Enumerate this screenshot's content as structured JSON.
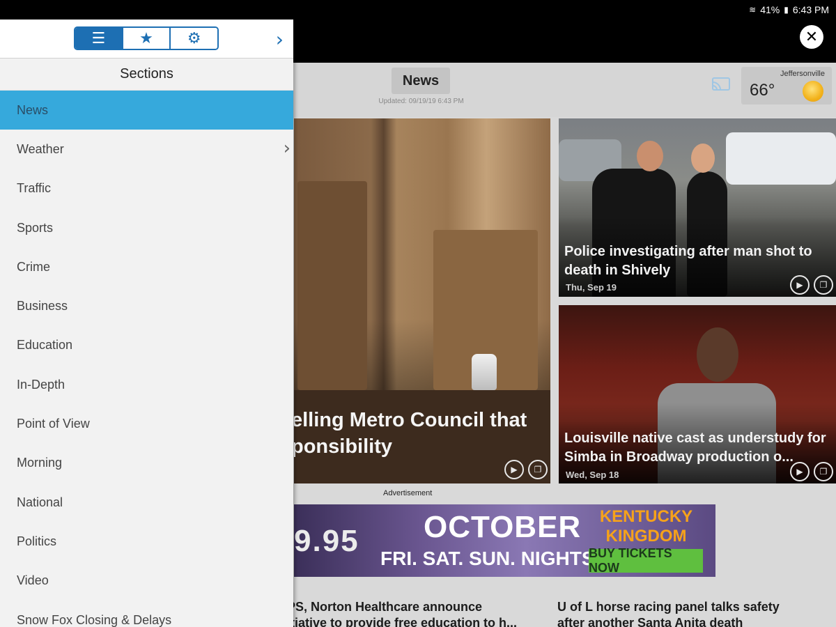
{
  "status_bar": {
    "battery": "41%",
    "time": "6:43 PM"
  },
  "header": {
    "section_title": "News",
    "updated_text": "Updated: 09/19/19 6:43 PM",
    "weather": {
      "city": "Jeffersonville",
      "temperature": "66°",
      "icon": "sun-icon"
    }
  },
  "drawer": {
    "tabs": [
      {
        "name": "sections",
        "icon": "list-icon",
        "glyph": "☰",
        "active": true
      },
      {
        "name": "favorites",
        "icon": "star-icon",
        "glyph": "★",
        "active": false
      },
      {
        "name": "settings",
        "icon": "gear-icon",
        "glyph": "⚙",
        "active": false
      }
    ],
    "title": "Sections",
    "items": [
      {
        "label": "News",
        "active": true
      },
      {
        "label": "Weather",
        "has_submenu": true
      },
      {
        "label": "Traffic"
      },
      {
        "label": "Sports"
      },
      {
        "label": "Crime"
      },
      {
        "label": "Business"
      },
      {
        "label": "Education"
      },
      {
        "label": "In-Depth"
      },
      {
        "label": "Point of View"
      },
      {
        "label": "Morning"
      },
      {
        "label": "National"
      },
      {
        "label": "Politics"
      },
      {
        "label": "Video"
      },
      {
        "label": "Snow Fox Closing & Delays"
      }
    ]
  },
  "stories": {
    "featured": {
      "headline_line1": "elling Metro Council that",
      "headline_line2": "ponsibility"
    },
    "side": [
      {
        "title": "Police investigating after man shot to death in Shively",
        "date": "Thu, Sep 19"
      },
      {
        "title": "Louisville native cast as understudy for Simba in Broadway production o...",
        "date": "Wed, Sep 18"
      }
    ],
    "bottom": [
      {
        "title_line1": "PS, Norton Healthcare announce",
        "title_line2": "itiative to provide free education to h..."
      },
      {
        "title_line1": "U of L horse racing panel talks safety",
        "title_line2": "after another Santa Anita death"
      }
    ]
  },
  "ad": {
    "label": "Advertisement",
    "price": "9.95",
    "month": "OCTOBER",
    "nights": "FRI. SAT. SUN. NIGHTS",
    "brand_line1": "KENTUCKY",
    "brand_line2": "KINGDOM",
    "cta": "BUY TICKETS NOW"
  },
  "colors": {
    "drawer_accent": "#1d6fb3",
    "active_item": "#36a9dc",
    "ad_brand": "#f6a21a",
    "ad_cta": "#5fbf3f"
  }
}
